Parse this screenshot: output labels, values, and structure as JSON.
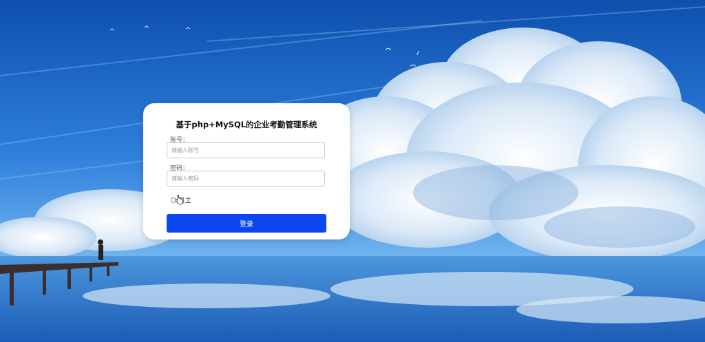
{
  "login": {
    "title": "基于php+MySQL的企业考勤管理系统",
    "account_label": "账号：",
    "account_placeholder": "请输入账号",
    "password_label": "密码：",
    "password_placeholder": "请输入密码",
    "role_option": "员工",
    "login_label": "登录"
  },
  "colors": {
    "accent": "#0c46f0",
    "sky": "#1a5fc4"
  }
}
